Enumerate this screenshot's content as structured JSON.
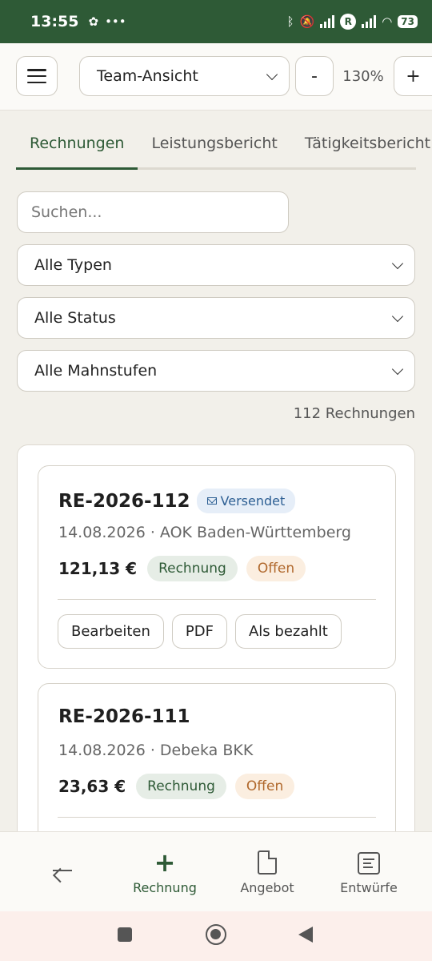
{
  "status_bar": {
    "time": "13:55",
    "battery": "73",
    "network_badge": "R"
  },
  "toolbar": {
    "view_select_value": "Team-Ansicht",
    "zoom_minus_label": "-",
    "zoom_level": "130%",
    "zoom_plus_label": "+"
  },
  "tabs": [
    {
      "label": "Rechnungen",
      "active": true
    },
    {
      "label": "Leistungsbericht",
      "active": false
    },
    {
      "label": "Tätigkeitsbericht",
      "active": false
    }
  ],
  "search": {
    "placeholder": "Suchen..."
  },
  "filters": {
    "type": "Alle Typen",
    "status": "Alle Status",
    "dunning": "Alle Mahnstufen"
  },
  "result_count": "112 Rechnungen",
  "invoices": [
    {
      "number": "RE-2026-112",
      "sent_badge": "Versendet",
      "date_customer": "14.08.2026 · AOK Baden-Württemberg",
      "amount": "121,13 €",
      "type": "Rechnung",
      "status": "Offen",
      "actions": {
        "edit": "Bearbeiten",
        "pdf": "PDF",
        "mark_paid": "Als bezahlt"
      }
    },
    {
      "number": "RE-2026-111",
      "date_customer": "14.08.2026 · Debeka BKK",
      "amount": "23,63 €",
      "type": "Rechnung",
      "status": "Offen"
    }
  ],
  "bottom_nav": {
    "new_invoice": "Rechnung",
    "offer": "Angebot",
    "drafts": "Entwürfe"
  },
  "colors": {
    "brand_green": "#2e5a36",
    "status_open": "#b0682c",
    "sent_blue": "#2d5f93"
  }
}
